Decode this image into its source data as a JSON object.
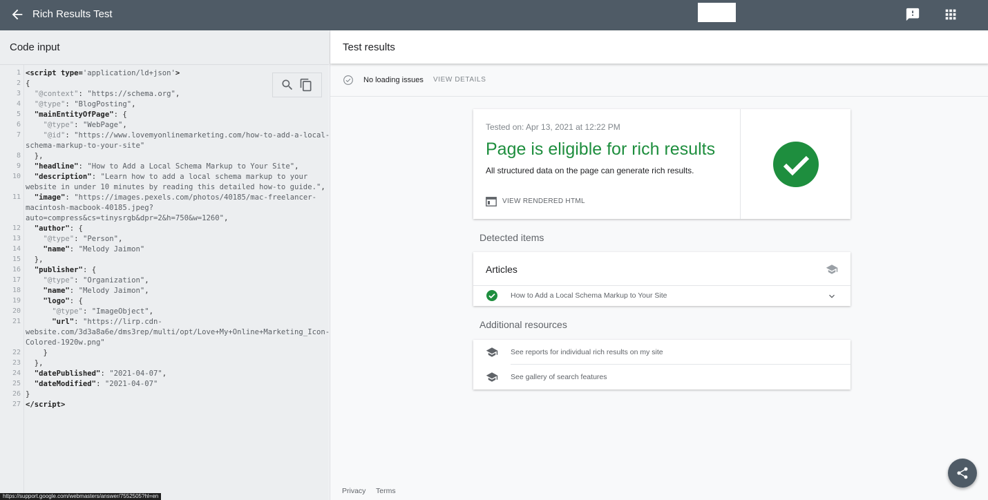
{
  "header": {
    "title": "Rich Results Test",
    "back_icon": "arrow-back-icon",
    "feedback_icon": "feedback-icon",
    "apps_icon": "apps-grid-icon",
    "bar_color": "#4f5b66"
  },
  "code_panel": {
    "title": "Code input",
    "search_icon": "search-icon",
    "copy_icon": "copy-icon"
  },
  "results": {
    "title": "Test results",
    "status_text": "No loading issues",
    "view_details": "VIEW DETAILS",
    "tested_on": "Tested on: Apr 13, 2021 at 12:22 PM",
    "eligible_title": "Page is eligible for rich results",
    "eligible_sub": "All structured data on the page can generate rich results.",
    "render_label": "VIEW RENDERED HTML",
    "success_color": "#1e8e3e",
    "detected_label": "Detected items",
    "articles_title": "Articles",
    "article_item": "How to Add a Local Schema Markup to Your Site",
    "additional_label": "Additional resources",
    "resources": [
      "See reports for individual rich results on my site",
      "See gallery of search features"
    ],
    "footer_privacy": "Privacy",
    "footer_terms": "Terms"
  },
  "browser_status_url": "https://support.google.com/webmasters/answer/7552505?hl=en"
}
